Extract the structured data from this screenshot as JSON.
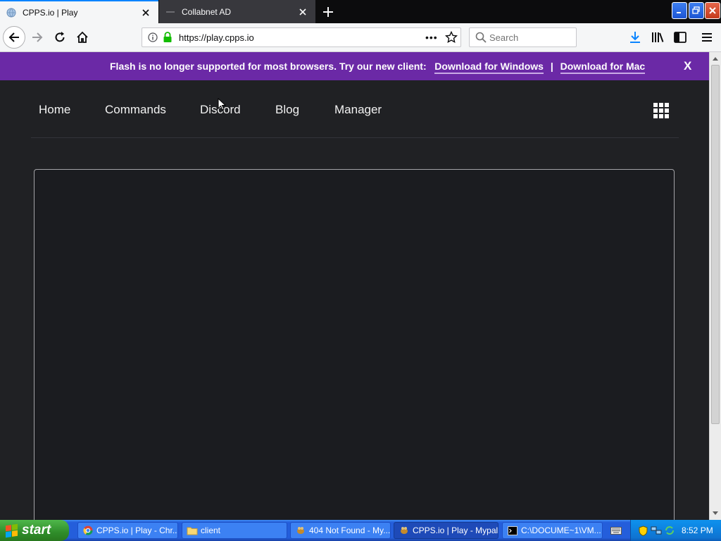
{
  "browser": {
    "tabs": [
      {
        "title": "CPPS.io | Play",
        "active": true
      },
      {
        "title": "Collabnet AD",
        "active": false
      }
    ],
    "url": "https://play.cpps.io",
    "search_placeholder": "Search"
  },
  "banner": {
    "message": "Flash is no longer supported for most browsers. Try our new client:",
    "download_windows": "Download for Windows",
    "separator": "|",
    "download_mac": "Download for Mac",
    "close": "X",
    "color": "#6b29a6"
  },
  "site_nav": {
    "links": [
      "Home",
      "Commands",
      "Discord",
      "Blog",
      "Manager"
    ]
  },
  "taskbar": {
    "start_label": "start",
    "tasks": [
      {
        "label": "CPPS.io | Play - Chr...",
        "icon": "chrome-icon"
      },
      {
        "label": "client",
        "icon": "folder-icon"
      },
      {
        "label": "404 Not Found - My...",
        "icon": "app-icon"
      },
      {
        "label": "CPPS.io | Play - Mypal",
        "icon": "app-icon",
        "active": true
      },
      {
        "label": "C:\\DOCUME~1\\VM...",
        "icon": "console-icon"
      }
    ],
    "clock": "8:52 PM"
  },
  "colors": {
    "page_bg": "#202124",
    "banner_bg": "#6b29a6",
    "accent": "#0a84ff",
    "taskbar": "#245edb",
    "start": "#2f8d2a"
  }
}
